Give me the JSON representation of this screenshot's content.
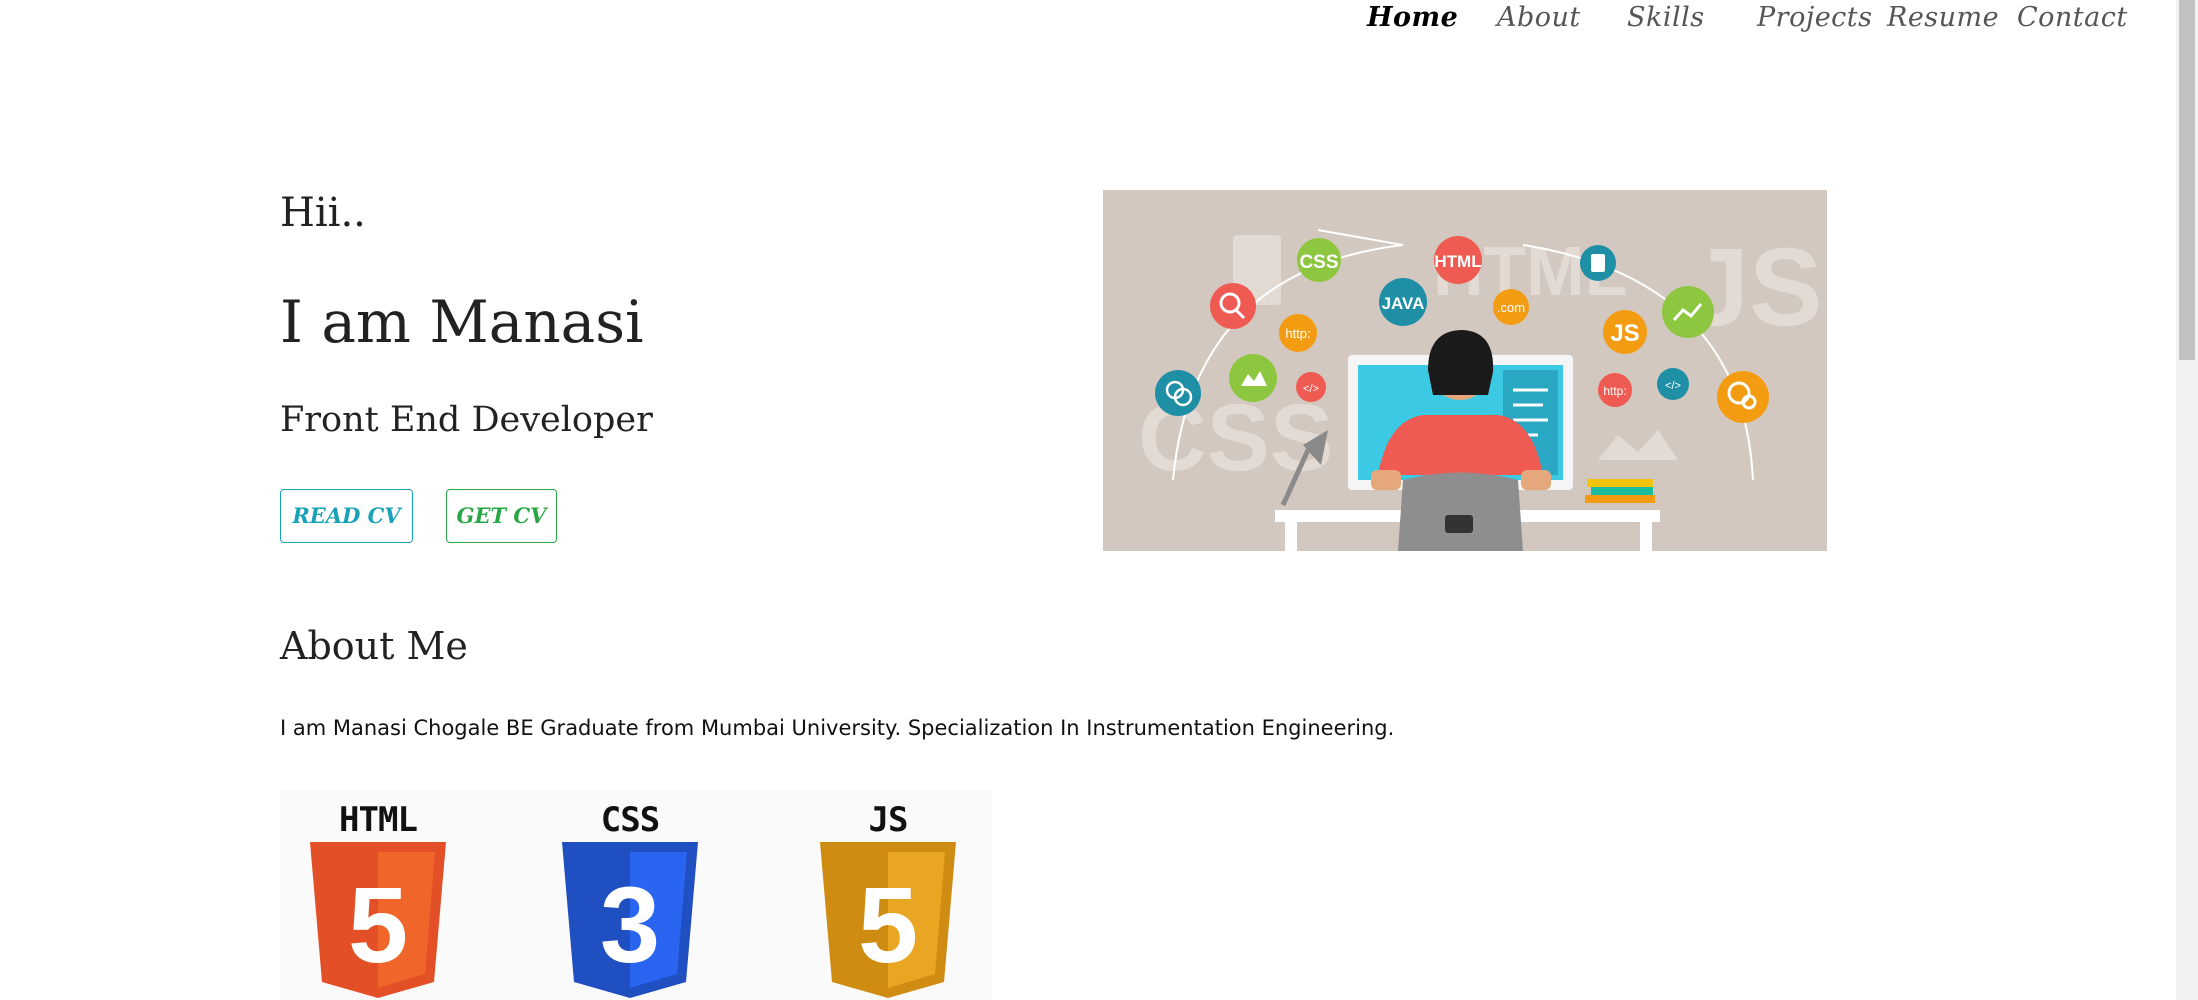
{
  "nav": {
    "items": [
      {
        "label": "Home",
        "active": true
      },
      {
        "label": "About",
        "active": false
      },
      {
        "label": "Skills",
        "active": false
      },
      {
        "label": "Projects",
        "active": false
      },
      {
        "label": "Resume",
        "active": false
      },
      {
        "label": "Contact",
        "active": false
      }
    ]
  },
  "hero": {
    "greeting": "Hii..",
    "name": "I am Manasi",
    "role": "Front End Developer",
    "read_cv_label": "READ CV",
    "get_cv_label": "GET CV",
    "illustration": {
      "icon_labels": [
        "CSS",
        "HTML",
        "JAVA",
        ".com",
        "JS",
        "http:",
        "</>",
        "http:",
        "</>",
        "HTML",
        "JS",
        "CSS"
      ]
    }
  },
  "about": {
    "title": "About Me",
    "text": "I am Manasi Chogale BE Graduate from Mumbai University. Specialization In Instrumentation Engineering."
  },
  "skills": {
    "logos": [
      {
        "caption": "HTML",
        "digit": "5",
        "color": "#e34f26",
        "dark": "#c03b17"
      },
      {
        "caption": "CSS",
        "digit": "3",
        "color": "#2965f1",
        "dark": "#1f4fc1"
      },
      {
        "caption": "JS",
        "digit": "5",
        "color": "#e8a623",
        "dark": "#cf8c12"
      }
    ]
  },
  "colors": {
    "info": "#17a2b8",
    "success": "#28a745",
    "illustration_bg": "#d3c8bf"
  }
}
